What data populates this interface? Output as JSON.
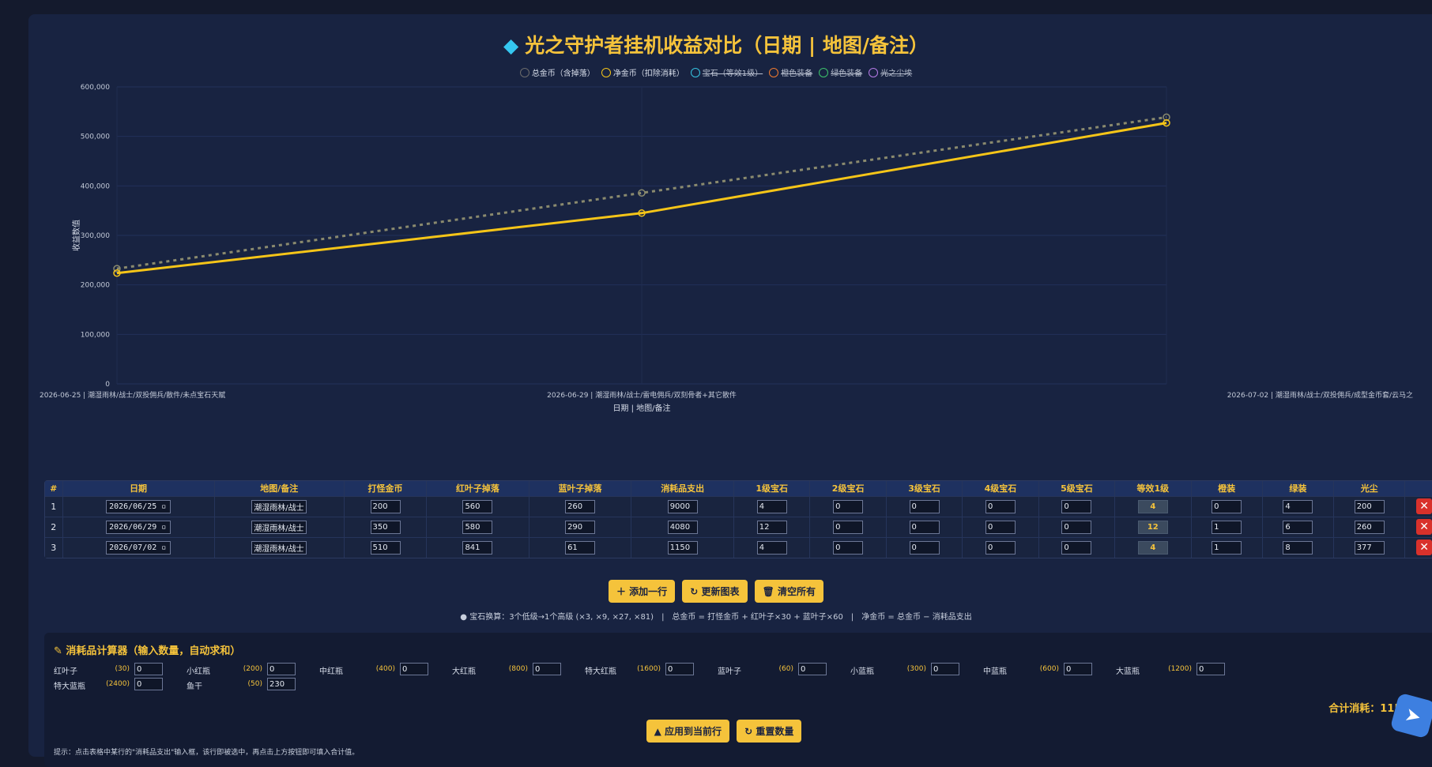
{
  "title": "光之守护者挂机收益对比（日期 | 地图/备注）",
  "title_icon": "gem-icon",
  "legend": [
    {
      "label": "总金币（含掉落）",
      "color": "#6b6b6b",
      "active": true
    },
    {
      "label": "净金币（扣除消耗）",
      "color": "#f5c518",
      "active": true
    },
    {
      "label": "宝石（等效1级）",
      "color": "#36c3e0",
      "active": false
    },
    {
      "label": "橙色装备",
      "color": "#f07a2f",
      "active": false
    },
    {
      "label": "绿色装备",
      "color": "#3cc36b",
      "active": false
    },
    {
      "label": "光之尘埃",
      "color": "#b57ae6",
      "active": false
    }
  ],
  "chart_data": {
    "type": "line",
    "categories": [
      "2026-06-25 | 潮湿雨林/战士/双投佣兵/散件/未点宝石天赋",
      "2026-06-29 | 潮湿雨林/战士/雷电佣兵/双刻骨者+其它散件",
      "2026-07-02 | 潮湿雨林/战士/双投佣兵/成型金币套/云马之"
    ],
    "series": [
      {
        "name": "总金币（含掉落）",
        "values": [
          232800,
          385800,
          538700
        ],
        "color": "#8a8a6e",
        "dashed": true
      },
      {
        "name": "净金币（扣除消耗）",
        "values": [
          223800,
          345000,
          527200
        ],
        "color": "#f5c518",
        "dashed": false
      }
    ],
    "xlabel": "日期 | 地图/备注",
    "ylabel": "收益数值",
    "ylim": [
      0,
      600000
    ],
    "yticks": [
      "0",
      "100,000",
      "200,000",
      "300,000",
      "400,000",
      "500,000",
      "600,000"
    ],
    "grid": true,
    "legend_position": "top-center"
  },
  "table": {
    "headers": [
      "#",
      "日期",
      "地图/备注",
      "打怪金币",
      "红叶子掉落",
      "蓝叶子掉落",
      "消耗品支出",
      "1级宝石",
      "2级宝石",
      "3级宝石",
      "4级宝石",
      "5级宝石",
      "等效1级",
      "橙装",
      "绿装",
      "光尘"
    ],
    "rows": [
      {
        "n": "1",
        "date": "2026/06/25",
        "map": "潮湿雨林/战士",
        "gold": "200",
        "red": "560",
        "blue": "260",
        "cons": "9000",
        "g1": "4",
        "g2": "0",
        "g3": "0",
        "g4": "0",
        "g5": "0",
        "eq": "4",
        "orange": "0",
        "green": "4",
        "dust": "200"
      },
      {
        "n": "2",
        "date": "2026/06/29",
        "map": "潮湿雨林/战士",
        "gold": "350",
        "red": "580",
        "blue": "290",
        "cons": "4080",
        "g1": "12",
        "g2": "0",
        "g3": "0",
        "g4": "0",
        "g5": "0",
        "eq": "12",
        "orange": "1",
        "green": "6",
        "dust": "260"
      },
      {
        "n": "3",
        "date": "2026/07/02",
        "map": "潮湿雨林/战士",
        "gold": "510",
        "red": "841",
        "blue": "61",
        "cons": "1150",
        "g1": "4",
        "g2": "0",
        "g3": "0",
        "g4": "0",
        "g5": "0",
        "eq": "4",
        "orange": "1",
        "green": "8",
        "dust": "377"
      }
    ],
    "delete_icon": "✕"
  },
  "buttons": {
    "add_row": "添加一行",
    "update_chart": "更新图表",
    "clear_all": "清空所有"
  },
  "tip": "宝石换算：3个低级→1个高级 (×3, ×9, ×27, ×81)　|　总金币 = 打怪金币 + 红叶子×30 + 蓝叶子×60　|　净金币 = 总金币 − 消耗品支出",
  "calc": {
    "title": "消耗品计算器（输入数量，自动求和）",
    "items": [
      {
        "name": "红叶子",
        "price": "(30)",
        "qty": "0"
      },
      {
        "name": "小红瓶",
        "price": "(200)",
        "qty": "0"
      },
      {
        "name": "中红瓶",
        "price": "(400)",
        "qty": "0"
      },
      {
        "name": "大红瓶",
        "price": "(800)",
        "qty": "0"
      },
      {
        "name": "特大红瓶",
        "price": "(1600)",
        "qty": "0"
      },
      {
        "name": "蓝叶子",
        "price": "(60)",
        "qty": "0"
      },
      {
        "name": "小蓝瓶",
        "price": "(300)",
        "qty": "0"
      },
      {
        "name": "中蓝瓶",
        "price": "(600)",
        "qty": "0"
      },
      {
        "name": "大蓝瓶",
        "price": "(1200)",
        "qty": "0"
      },
      {
        "name": "特大蓝瓶",
        "price": "(2400)",
        "qty": "0"
      },
      {
        "name": "鱼干",
        "price": "(50)",
        "qty": "230"
      }
    ],
    "total_label": "合计消耗：",
    "total_value": "11500 金币",
    "apply_btn": "应用到当前行",
    "reset_btn": "重置数量",
    "hint": "提示：点击表格中某行的\"消耗品支出\"输入框，该行即被选中，再点击上方按钮即可填入合计值。"
  }
}
